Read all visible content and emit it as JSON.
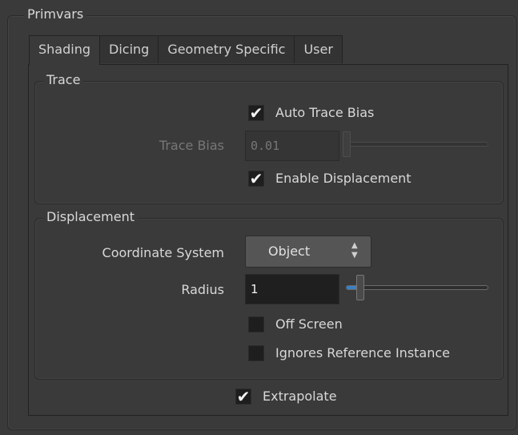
{
  "primvars": {
    "title": "Primvars",
    "tabs": [
      {
        "label": "Shading",
        "active": true
      },
      {
        "label": "Dicing",
        "active": false
      },
      {
        "label": "Geometry Specific",
        "active": false
      },
      {
        "label": "User",
        "active": false
      }
    ],
    "trace": {
      "title": "Trace",
      "auto_trace_bias_label": "Auto Trace Bias",
      "auto_trace_bias_checked": true,
      "trace_bias_label": "Trace Bias",
      "trace_bias_value": "0.01",
      "trace_bias_enabled": false,
      "enable_displacement_label": "Enable Displacement",
      "enable_displacement_checked": true
    },
    "displacement": {
      "title": "Displacement",
      "coordinate_system_label": "Coordinate System",
      "coordinate_system_value": "Object",
      "radius_label": "Radius",
      "radius_value": "1",
      "off_screen_label": "Off Screen",
      "off_screen_checked": false,
      "ignores_reference_instance_label": "Ignores Reference Instance",
      "ignores_reference_instance_checked": false
    },
    "extrapolate_label": "Extrapolate",
    "extrapolate_checked": true
  },
  "icons": {
    "check": "✔",
    "spinner": "up-down-arrows-icon"
  },
  "colors": {
    "background": "#3a3a3a",
    "field": "#1f1f1f",
    "text": "#d8d8d8",
    "disabled_text": "#777777"
  }
}
